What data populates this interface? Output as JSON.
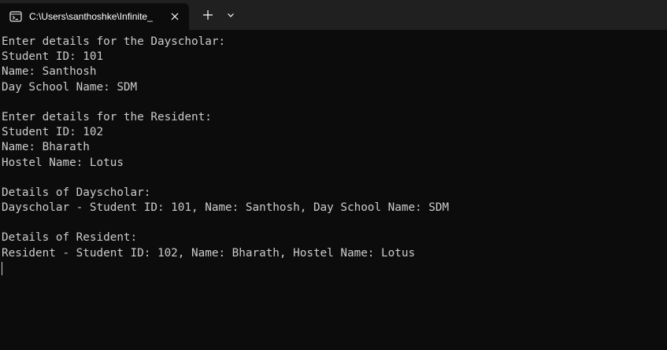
{
  "tab": {
    "title": "C:\\Users\\santhoshke\\Infinite_",
    "icon": "terminal-icon"
  },
  "toolbar": {
    "close_icon": "close-icon",
    "new_tab_icon": "plus-icon",
    "dropdown_icon": "chevron-down-icon"
  },
  "colors": {
    "background": "#0c0c0c",
    "titlebar": "#202020",
    "text": "#cccccc"
  },
  "console": {
    "lines": [
      "Enter details for the Dayscholar:",
      "Student ID: 101",
      "Name: Santhosh",
      "Day School Name: SDM",
      "",
      "Enter details for the Resident:",
      "Student ID: 102",
      "Name: Bharath",
      "Hostel Name: Lotus",
      "",
      "Details of Dayscholar:",
      "Dayscholar - Student ID: 101, Name: Santhosh, Day School Name: SDM",
      "",
      "Details of Resident:",
      "Resident - Student ID: 102, Name: Bharath, Hostel Name: Lotus"
    ]
  }
}
